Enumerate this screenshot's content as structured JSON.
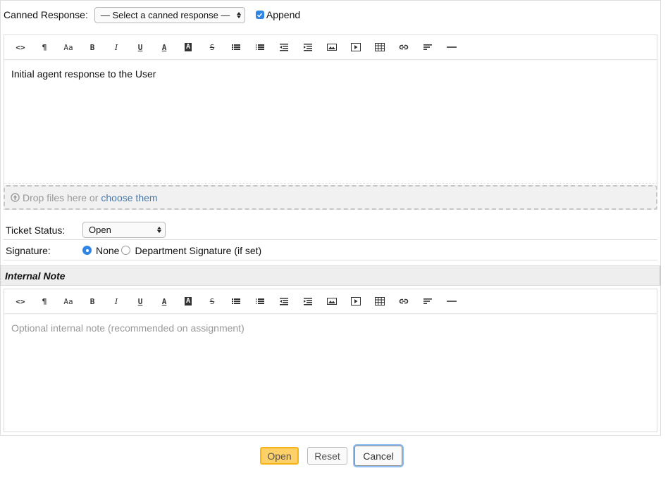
{
  "canned": {
    "label": "Canned Response:",
    "selected": "— Select a canned response —",
    "append_label": "Append",
    "append_checked": true
  },
  "toolbar": {
    "buttons": [
      {
        "name": "html-code",
        "glyph": "<>"
      },
      {
        "name": "paragraph",
        "glyph": "¶"
      },
      {
        "name": "font-size",
        "glyph": "Aa"
      },
      {
        "name": "bold",
        "glyph": "B"
      },
      {
        "name": "italic",
        "glyph": "I"
      },
      {
        "name": "underline",
        "glyph": "U"
      },
      {
        "name": "font-color",
        "glyph": "A"
      },
      {
        "name": "background-color",
        "glyph": "A"
      },
      {
        "name": "strikethrough",
        "glyph": "S"
      },
      {
        "name": "unordered-list",
        "glyph": "ul"
      },
      {
        "name": "ordered-list",
        "glyph": "ol"
      },
      {
        "name": "outdent",
        "glyph": "outdent"
      },
      {
        "name": "indent",
        "glyph": "indent"
      },
      {
        "name": "image",
        "glyph": "image"
      },
      {
        "name": "video",
        "glyph": "video"
      },
      {
        "name": "table",
        "glyph": "table"
      },
      {
        "name": "link",
        "glyph": "link"
      },
      {
        "name": "alignment",
        "glyph": "align"
      },
      {
        "name": "horizontal-rule",
        "glyph": "hr"
      }
    ]
  },
  "response_editor": {
    "content": "Initial agent response to the User"
  },
  "dropzone": {
    "text": "Drop files here or",
    "link": "choose them"
  },
  "ticket_status": {
    "label": "Ticket Status:",
    "selected": "Open"
  },
  "signature": {
    "label": "Signature:",
    "options": [
      {
        "label": "None",
        "selected": true
      },
      {
        "label": "Department Signature (if set)",
        "selected": false
      }
    ]
  },
  "internal_note": {
    "title": "Internal Note",
    "placeholder": "Optional internal note (recommended on assignment)"
  },
  "actions": {
    "open": "Open",
    "reset": "Reset",
    "cancel": "Cancel"
  },
  "colors": {
    "primary_button": "#fdd068",
    "primary_border": "#f8b319",
    "focus_ring": "#8fc0f5",
    "link": "#4a79a8",
    "checkbox": "#2f86e6"
  }
}
